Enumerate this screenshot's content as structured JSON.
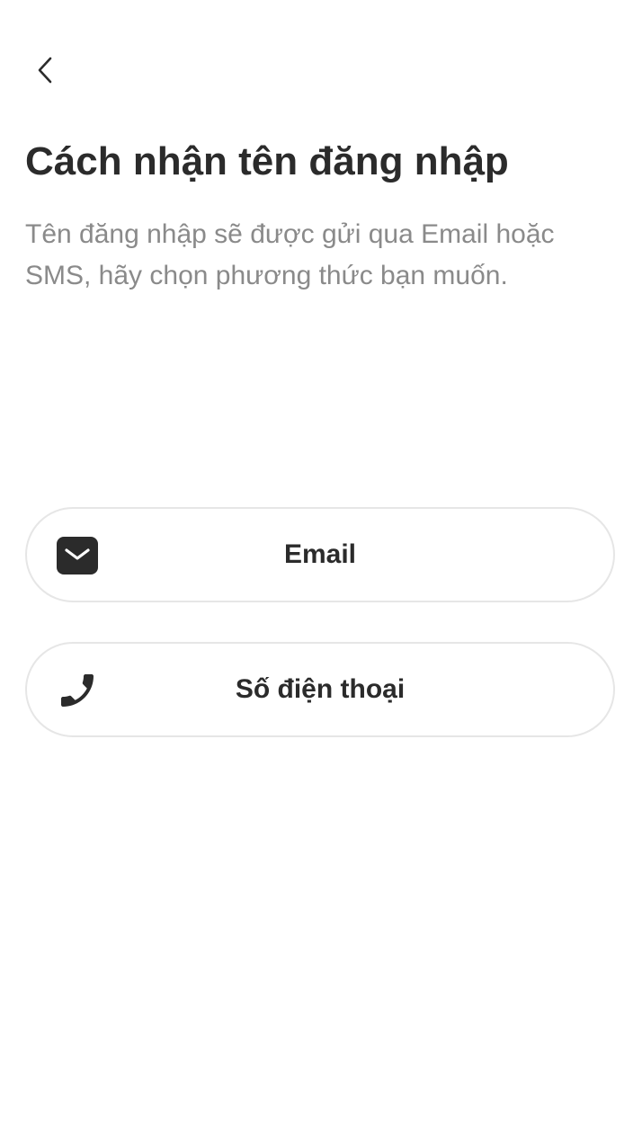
{
  "header": {
    "back_icon": "chevron-left-icon"
  },
  "main": {
    "title": "Cách nhận tên đăng nhập",
    "subtitle": "Tên đăng nhập sẽ được gửi qua Email hoặc SMS, hãy chọn phương thức bạn muốn."
  },
  "options": [
    {
      "label": "Email",
      "icon": "mail-icon"
    },
    {
      "label": "Số điện thoại",
      "icon": "phone-icon"
    }
  ],
  "colors": {
    "text_primary": "#2b2b2b",
    "text_secondary": "#8a8a8a",
    "border": "#e6e6e6",
    "background": "#ffffff"
  }
}
